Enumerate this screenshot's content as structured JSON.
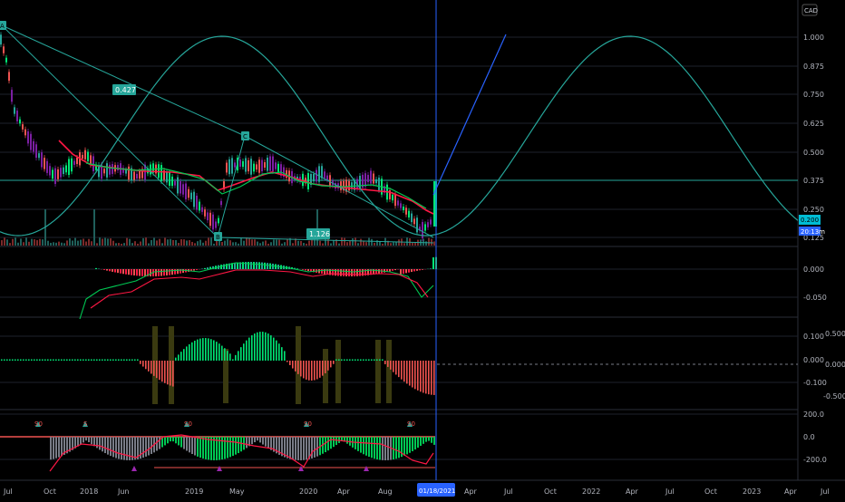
{
  "currency": "CAD",
  "price_axis": {
    "labels": [
      "1.000",
      "0.875",
      "0.750",
      "0.625",
      "0.500",
      "0.375",
      "0.250",
      "0.125"
    ],
    "last_price": "0.200",
    "countdown": "20:13m"
  },
  "time_axis": {
    "labels": [
      "Jul",
      "Oct",
      "2018",
      "Jun",
      "2019",
      "May",
      "2020",
      "Apr",
      "Aug",
      "Apr",
      "Jul",
      "Oct",
      "2022",
      "Apr",
      "Jul",
      "Oct",
      "2023",
      "Apr",
      "Jul"
    ],
    "cursor_date": "01/18/2021"
  },
  "annotations": {
    "point_a": "A",
    "point_b": "B",
    "point_c": "C",
    "ratio_upper": "0.427",
    "ratio_lower": "1.126"
  },
  "macd": {
    "labels": [
      "0.000",
      "-0.050"
    ]
  },
  "oscillator": {
    "left_labels": [
      "0.100",
      "0.000",
      "-0.100"
    ],
    "right_labels": [
      "0.500",
      "0.000",
      "-0.500"
    ]
  },
  "momentum": {
    "labels": [
      "200.0",
      "0.0",
      "-200.0"
    ]
  },
  "signal_markers": [
    "S0",
    "S",
    "S0",
    "S0",
    "S0"
  ],
  "colors": {
    "up": "#26a69a",
    "down": "#ef5350",
    "green": "#00e676",
    "red": "#ff1744",
    "teal": "#26a69a",
    "cursor": "#2962ff",
    "background": "#000000"
  }
}
